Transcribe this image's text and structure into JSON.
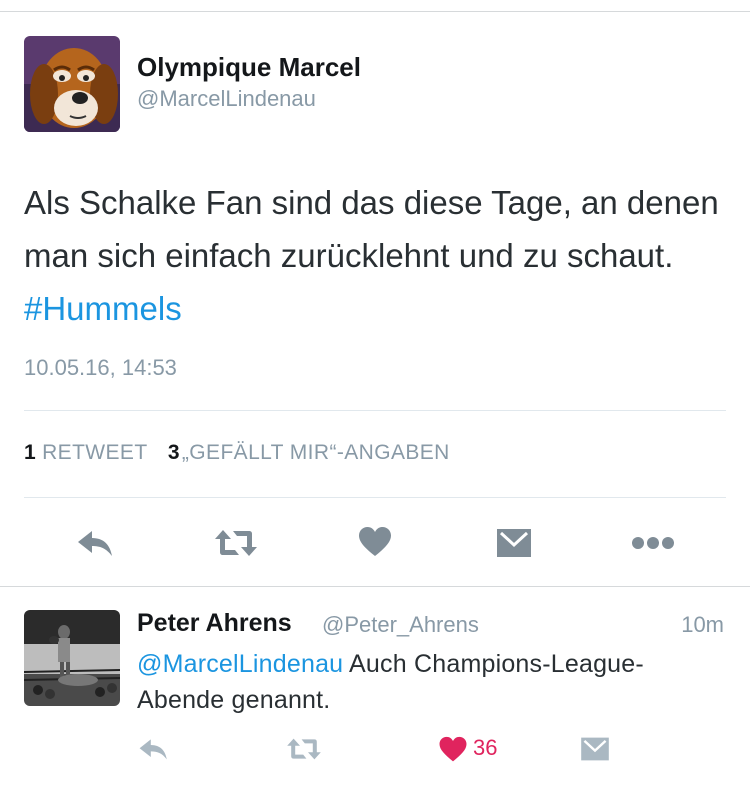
{
  "tweet": {
    "author_name": "Olympique Marcel",
    "author_handle": "@MarcelLindenau",
    "text_before_hashtag": "Als Schalke Fan sind das diese Tage, an denen man sich einfach zurücklehnt und zu schaut. ",
    "hashtag": "#Hummels",
    "timestamp": "10.05.16, 14:53",
    "retweet_count": "1",
    "retweet_label": "RETWEET",
    "like_count": "3",
    "like_label": "„GEFÄLLT MIR“-ANGABEN",
    "avatar": "cartoon-dog-avatar"
  },
  "actions": [
    "reply-icon",
    "retweet-icon",
    "heart-icon",
    "message-icon",
    "more-icon"
  ],
  "reply": {
    "author_name": "Peter Ahrens",
    "author_handle": "@Peter_Ahrens",
    "time": "10m",
    "mention": "@MarcelLindenau",
    "text": " Auch Champions-League-Abende genannt.",
    "like_count": "36",
    "avatar": "boxing-photo-avatar"
  },
  "colors": {
    "link": "#1b95e0",
    "secondary_text": "#8899a6",
    "action_icon_main": "#7f8c96",
    "action_icon_reply": "#aab8c2",
    "liked": "#e0245e"
  }
}
